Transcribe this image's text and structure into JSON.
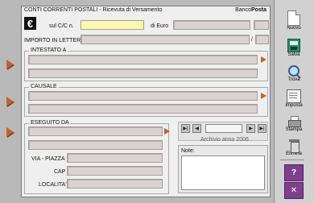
{
  "header": {
    "title": "CONTI CORRENTI POSTALI - Ricevuta di Versamento",
    "brand_plain": "Banco",
    "brand_bold": "Posta",
    "currency_symbol": "€"
  },
  "account": {
    "label": "sul C/C n.",
    "value": "",
    "euro_label": "di Euro",
    "amount_value": "",
    "amount_cents": ""
  },
  "amount_words": {
    "label": "IMPORTO IN LETTERE",
    "value": "",
    "cents": "",
    "separator": "/"
  },
  "sections": {
    "intestato": "INTESTATO A",
    "causale": "CAUSALE",
    "eseguito": "ESEGUITO DA"
  },
  "address": {
    "street_label": "VIA - PIAZZA",
    "cap_label": "CAP",
    "city_label": "LOCALITA'"
  },
  "archive": {
    "label": "Archivio anno 2006"
  },
  "notes": {
    "label": "Note:"
  },
  "toolbar": {
    "nuovo": "Nuovo",
    "salva": "Salva",
    "trova": "Trova",
    "imposta": "Imposta",
    "stampa": "Stampa",
    "elimina": "Elimina",
    "help": "?",
    "close": "✕"
  },
  "colors": {
    "background": "#b9b9b9",
    "panel": "#efefef",
    "field": "#d9d4d4",
    "accent_arrow": "#c0632f",
    "active_field": "#fbf8b5",
    "purple_button": "#7f3f8f"
  }
}
